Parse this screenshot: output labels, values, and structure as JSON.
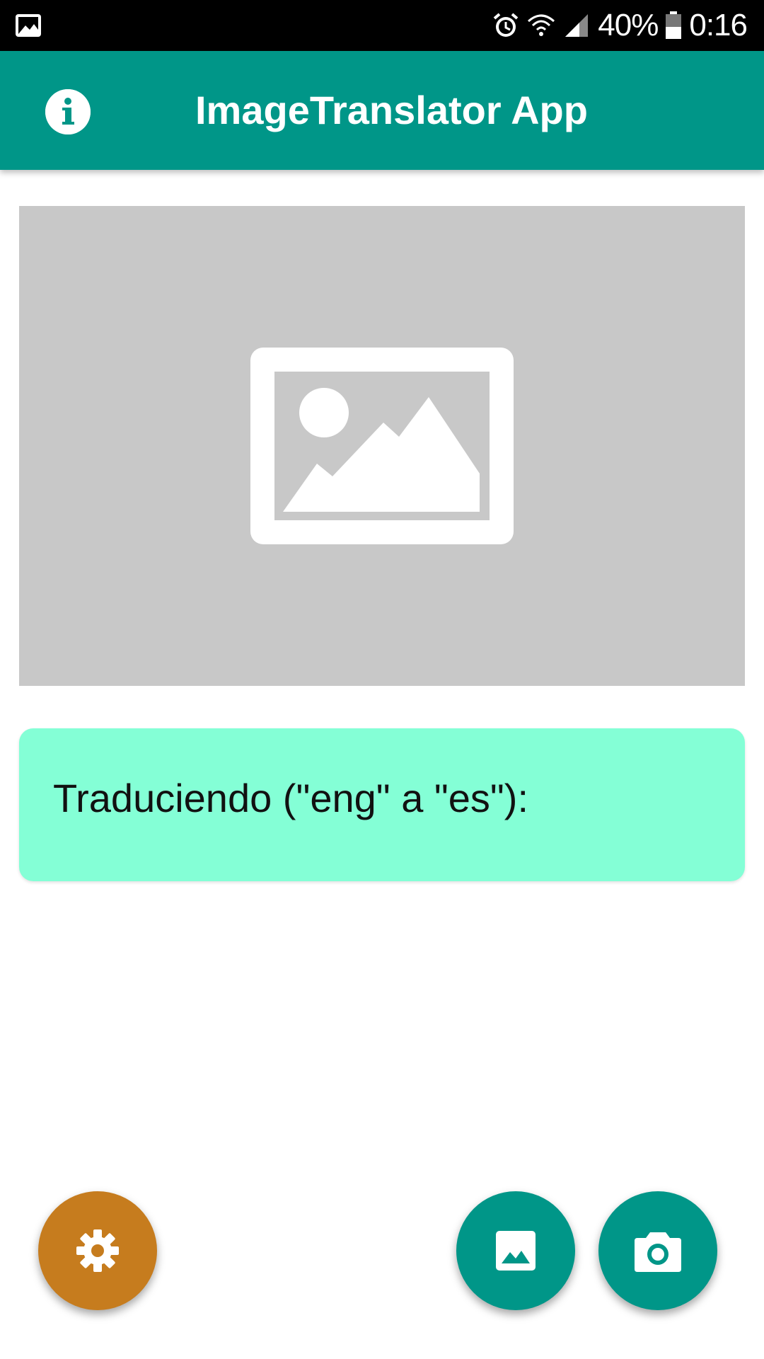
{
  "status_bar": {
    "battery_percent": "40%",
    "time": "0:16",
    "icons": [
      "image-notification-icon",
      "alarm-icon",
      "wifi-icon",
      "signal-icon",
      "battery-icon"
    ]
  },
  "app_bar": {
    "title": "ImageTranslator App",
    "info_icon": "info-icon",
    "background_color": "#009688"
  },
  "image_view": {
    "icon": "image-placeholder-icon",
    "background_color": "#c8c8c8"
  },
  "translation_card": {
    "text": "Traduciendo (\"eng\" a \"es\"):",
    "background_color": "#84ffd6"
  },
  "fabs": {
    "settings": {
      "icon": "gear-icon",
      "color": "#c67c1e"
    },
    "gallery": {
      "icon": "gallery-icon",
      "color": "#009688"
    },
    "camera": {
      "icon": "camera-icon",
      "color": "#009688"
    }
  }
}
